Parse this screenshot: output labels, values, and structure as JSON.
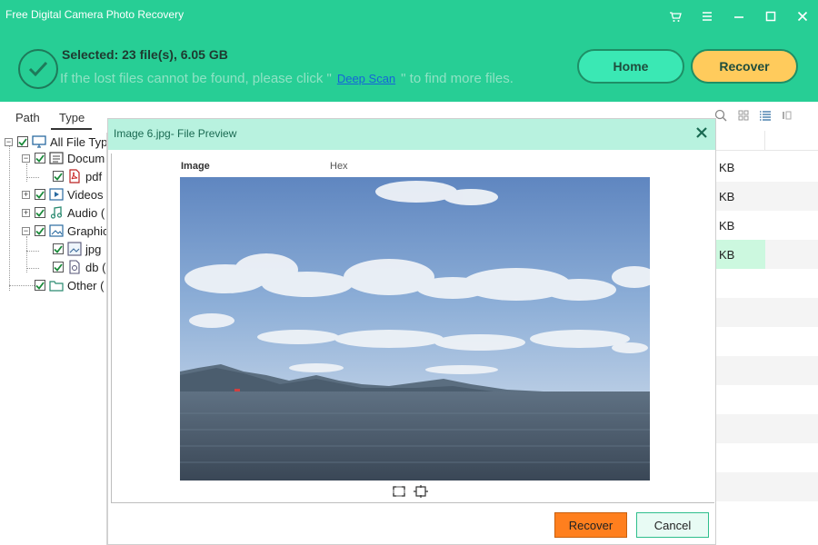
{
  "window": {
    "title": "Free Digital Camera Photo Recovery",
    "controls": [
      "cart-icon",
      "menu-icon",
      "minimize-icon",
      "maximize-icon",
      "close-icon"
    ]
  },
  "header": {
    "selected": "Selected: 23 file(s), 6.05 GB",
    "hint_before": "If the lost files cannot be found, please click \"",
    "deep_scan_link": "Deep Scan",
    "hint_after": "\" to find more files.",
    "home_button": "Home",
    "recover_button": "Recover",
    "colors": {
      "header_bg": "#27ce95",
      "home_bg": "#3ae8b4",
      "recover_bg": "#ffcb5c"
    }
  },
  "left_panel": {
    "tabs": [
      {
        "label": "Path"
      },
      {
        "label": "Type",
        "active": true
      }
    ],
    "tree": [
      {
        "label": "All File Typ",
        "icon": "monitor-icon",
        "checked": true,
        "expander": "-"
      },
      {
        "label": "Docum",
        "icon": "document-icon",
        "checked": true,
        "expander": "-"
      },
      {
        "label": "pdf",
        "icon": "pdf-icon",
        "checked": true
      },
      {
        "label": "Videos",
        "icon": "video-icon",
        "checked": true,
        "expander": "+"
      },
      {
        "label": "Audio (",
        "icon": "music-icon",
        "checked": true,
        "expander": "+"
      },
      {
        "label": "Graphic",
        "icon": "image-icon",
        "checked": true,
        "expander": "-"
      },
      {
        "label": "jpg",
        "icon": "jpg-file-icon",
        "checked": true
      },
      {
        "label": "db (",
        "icon": "db-file-icon",
        "checked": true
      },
      {
        "label": "Other (",
        "icon": "folder-icon",
        "checked": true
      }
    ]
  },
  "file_list": {
    "view_icons": [
      "search-icon",
      "grid-view-icon",
      "list-view-icon",
      "detail-view-icon"
    ],
    "rows": [
      {
        "size": "KB"
      },
      {
        "size": "KB"
      },
      {
        "size": "KB"
      },
      {
        "size": "KB",
        "selected": true
      }
    ]
  },
  "preview_dialog": {
    "title": "Image 6.jpg- File Preview",
    "columns": {
      "image": "Image",
      "hex": "Hex"
    },
    "tools": [
      "fit-icon",
      "actual-size-icon"
    ],
    "recover_button": "Recover",
    "cancel_button": "Cancel",
    "colors": {
      "title_bg": "#b8f2df",
      "recover_bg": "#ff7f1e",
      "cancel_bg": "#e8fbf4"
    }
  }
}
